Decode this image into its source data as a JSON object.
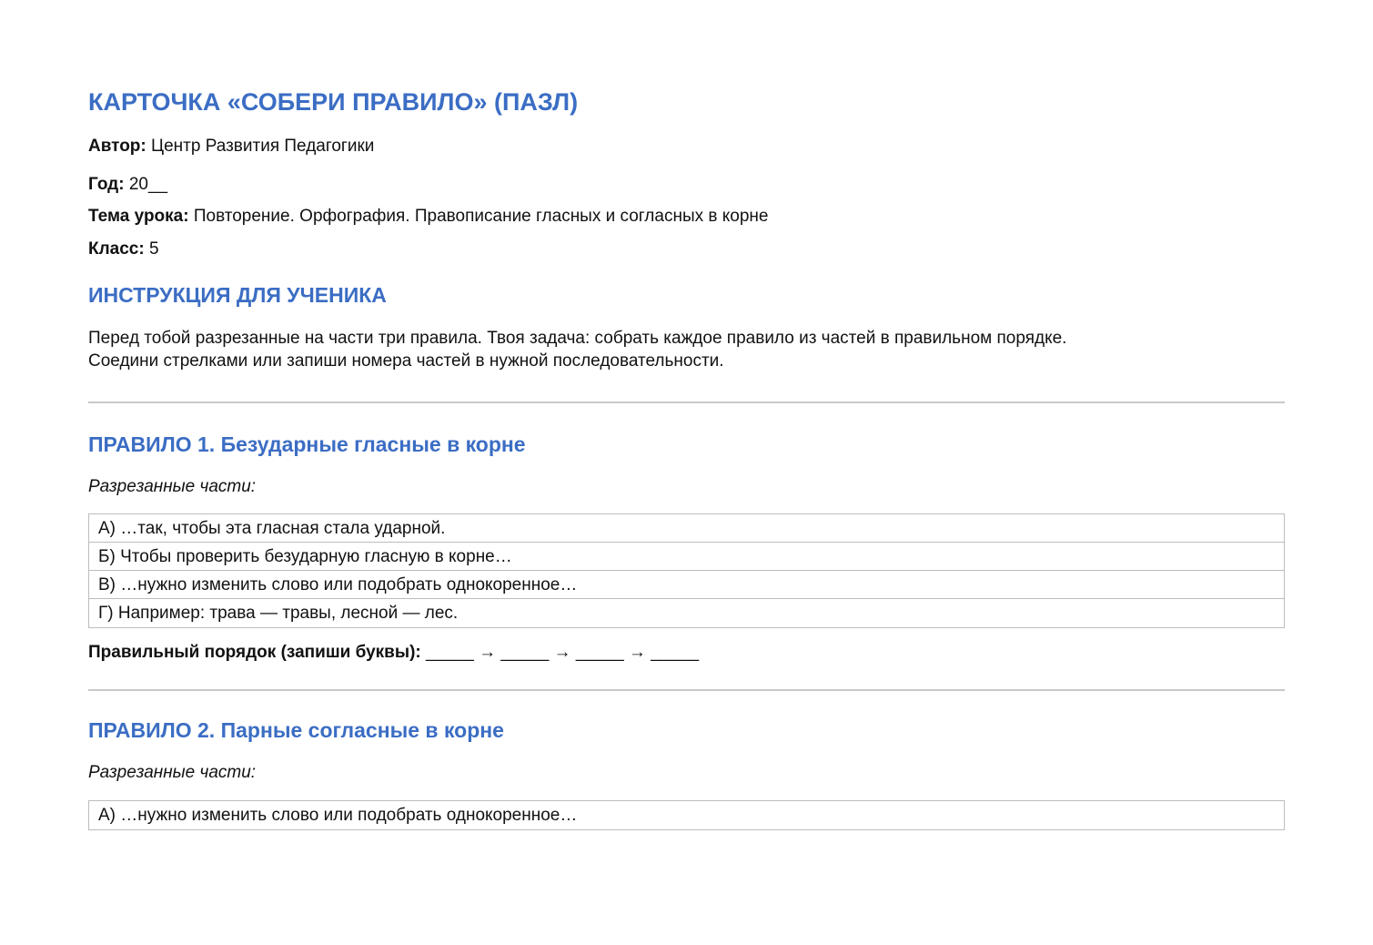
{
  "card": {
    "title": "КАРТОЧКА «СОБЕРИ ПРАВИЛО» (ПАЗЛ)",
    "meta": [
      {
        "label": "Автор:",
        "value": "Центр Развития Педагогики"
      },
      {
        "label": "Год:",
        "value": "20__"
      },
      {
        "label": "Тема урока:",
        "value": "Повторение. Орфография. Правописание гласных и согласных в корне"
      },
      {
        "label": "Класс:",
        "value": "5"
      }
    ]
  },
  "instruction": {
    "heading": "ИНСТРУКЦИЯ ДЛЯ УЧЕНИКА",
    "lines": [
      "Перед тобой разрезанные на части три правила. Твоя задача: собрать каждое правило из частей в правильном порядке.",
      "Соедини стрелками или запиши номера частей в нужной последовательности."
    ]
  },
  "rules": [
    {
      "heading": "ПРАВИЛО 1. Безударные гласные в корне",
      "parts_label": "Разрезанные части:",
      "parts": [
        "А) …так, чтобы эта гласная стала ударной.",
        "Б) Чтобы проверить безударную гласную в корне…",
        "В) …нужно изменить слово или подобрать однокоренное…",
        "Г) Например: трава — травы, лесной — лес."
      ],
      "order_label": "Правильный порядок (запиши буквы):",
      "order_blanks": "_____ → _____ → _____ → _____"
    },
    {
      "heading": "ПРАВИЛО 2. Парные согласные в корне",
      "parts_label": "Разрезанные части:",
      "parts": [
        "А) …нужно изменить слово или подобрать однокоренное…"
      ]
    }
  ],
  "colors": {
    "heading_blue": "#3b6dc4",
    "divider": "#c9c9c9",
    "table_border": "#bdbdbd"
  }
}
